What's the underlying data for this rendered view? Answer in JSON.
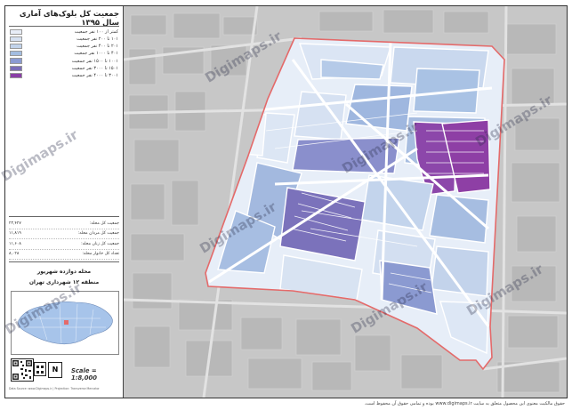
{
  "legend": {
    "title": "جمعیت کل بلوک‌های آماری سال ۱۳۹۵",
    "classes": [
      {
        "label": "کمتر از ۱۰۰ نفر جمعیت",
        "color": "#e8edf7"
      },
      {
        "label": "۱۰۱ تا ۲۰۰ نفر جمعیت",
        "color": "#d6e1f1"
      },
      {
        "label": "۲۰۱ تا ۴۰۰ نفر جمعیت",
        "color": "#c1d3eb"
      },
      {
        "label": "۴۰۱ تا ۱۰۰۰ نفر جمعیت",
        "color": "#a3bde0"
      },
      {
        "label": "۱۰۰۱ تا ۱۵۰۰ نفر جمعیت",
        "color": "#8b9bd2"
      },
      {
        "label": "۱۵۰۱ تا ۳۰۰۰ نفر جمعیت",
        "color": "#7a6db8"
      },
      {
        "label": "۳۰۰۱ تا ۴۰۰۰ نفر جمعیت",
        "color": "#8a3fa6"
      }
    ]
  },
  "stats": [
    {
      "label": "جمعیت کل محله:",
      "value": "۲۳,۴۲۷"
    },
    {
      "label": "جمعیت کل مردان محله:",
      "value": "۱۱,۸۱۹"
    },
    {
      "label": "جمعیت کل زنان محله:",
      "value": "۱۱,۶۰۸"
    },
    {
      "label": "تعداد کل خانوار محله:",
      "value": "۸,۰۲۸"
    }
  ],
  "area": {
    "neighborhood": "محله دوازده شهریور",
    "district": "منطقه ۱۲ شهرداری تهران"
  },
  "north_label": "N",
  "scale": "Scale = 1:8,000",
  "credit": "Data Source: www.Digimaps.ir | Projection: Transverse Mercator",
  "watermark": "Digimaps.ir",
  "footer": "حقوق مالکیت معنوی این محصول متعلق به سایت www.digimaps.ir بوده و تمامی حقوق آن محفوظ است.",
  "colors": {
    "boundary": "#e46a6a",
    "base_map": "#c9c9c9",
    "neighborhood_fill": "#e7eef8"
  }
}
